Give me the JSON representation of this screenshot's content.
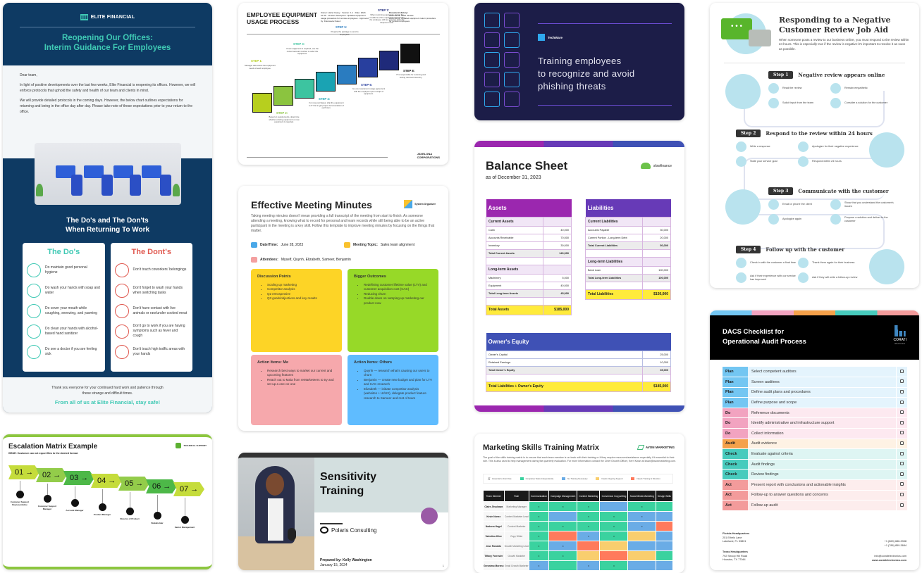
{
  "elite": {
    "brand": "ELITE FINANCIAL",
    "title_line1": "Reopening Our Offices:",
    "title_line2": "Interim Guidance For Employees",
    "greeting": "Dear team,",
    "para1": "In light of positive developments over the last few weeks, Elite Financial is reopening its offices. However, we will enforce protocols that uphold the safety and health of our team and clients in mind.",
    "para2": "We will provide detailed protocols in the coming days. However, the below chart outlines expectations for returning and being in the office day after day. Please take note of these expectations prior to your return to the office.",
    "section_line1": "The Do's and The Don'ts",
    "section_line2": "When Returning To Work",
    "dos_title": "The Do's",
    "donts_title": "The Dont's",
    "dos": [
      {
        "icon": "bathtub-icon",
        "text": "Do maintain good personal hygiene"
      },
      {
        "icon": "soap-icon",
        "text": "Do wash your hands with soap and water"
      },
      {
        "icon": "cough-icon",
        "text": "Do cover your mouth while coughing, sneezing, and yawning"
      },
      {
        "icon": "sanitizer-icon",
        "text": "Do clean your hands with alcohol-based hand sanitizer"
      },
      {
        "icon": "stethoscope-icon",
        "text": "Do see a doctor if you are feeling sick"
      }
    ],
    "donts": [
      {
        "icon": "desk-icon",
        "text": "Don't touch coworkers' belongings"
      },
      {
        "icon": "no-hands-icon",
        "text": "Don't forget to wash your hands when switching tasks"
      },
      {
        "icon": "utensils-icon",
        "text": "Don't have contact with live animals or raw/under cooked meat"
      },
      {
        "icon": "thermometer-icon",
        "text": "Don't go to work if you are having symptoms such as fever and cough"
      },
      {
        "icon": "pointing-hand-icon",
        "text": "Don't touch high traffic areas with your hands"
      }
    ],
    "thanks": "Thank you everyone for your continued hard work and patience through these strange and difficult times.",
    "signoff": "From all of us at Elite Financial, stay safe!",
    "colors": {
      "navy": "#0e3a63",
      "teal": "#3fc9b4",
      "red": "#e0584f"
    }
  },
  "escalation": {
    "title": "Escalation Matrix Example",
    "issue": "ISSUE: Customer can not export files to the desired format.",
    "brand": "TECHNICAL SUPPORT",
    "steps": [
      {
        "num": "01",
        "role": "Customer Support Representative",
        "color": "#c5dc3b"
      },
      {
        "num": "02",
        "role": "Customer Support Manager",
        "color": "#93cc4a"
      },
      {
        "num": "03",
        "role": "Account Manager",
        "color": "#4db848"
      },
      {
        "num": "04",
        "role": "Product Manager",
        "color": "#c5dc3b"
      },
      {
        "num": "05",
        "role": "Director of Product",
        "color": "#93cc4a"
      },
      {
        "num": "06",
        "role": "Stakeholder",
        "color": "#4db848"
      },
      {
        "num": "07",
        "role": "Senior Management",
        "color": "#c5dc3b"
      }
    ]
  },
  "equipment": {
    "title_line1": "EMPLOYEE EQUIPMENT",
    "title_line2": "USAGE PROCESS",
    "meta": "Owner: Hazel Casey · Version: 1.1 · Date: 2023-10-16 · Version description: Updated equipment usage procedure for remote employees · Approved by: Francesca Nunez",
    "history_title": "Document History:",
    "history": [
      "2022-09-29: Initial release",
      "2023-10-16: Updated equipment return procedure for remote employees"
    ],
    "steps": [
      {
        "label": "STEP 1:",
        "desc": "Manager will assess the equipment needs of each employee.",
        "color": "#b7cf1e"
      },
      {
        "label": "STEP 2:",
        "desc": "Based on requirements, determine whether existing equipment or new equipment is required.",
        "color": "#8bc43f"
      },
      {
        "label": "STEP 3:",
        "desc": "If new equipment is required, use the correct account number to order the equipment.",
        "color": "#3dc4a0"
      },
      {
        "label": "STEP 4:",
        "desc": "For new purchases, ship the equipment to IT first to get proper documentation of each item.",
        "color": "#1aa3b3"
      },
      {
        "label": "STEP 5:",
        "desc": "Prepare the package to send to employees.",
        "color": "#2a7cc0"
      },
      {
        "label": "STEP 6:",
        "desc": "Go over equipment usage agreement with the employee upon receipt of equipment.",
        "color": "#283f9e"
      },
      {
        "label": "STEP 7:",
        "desc": "When returning equipment, review the conditions of the equipment and provide the employee with an expense claim for shipment costs.",
        "color": "#1f2a7a"
      },
      {
        "label": "STEP 8:",
        "desc": "IT is responsible for receiving and storing returned inventory.",
        "color": "#111111"
      }
    ],
    "brand_line1": "JAVELONA",
    "brand_line2": "CORPORATIONS"
  },
  "meeting": {
    "title": "Effective Meeting Minutes",
    "brand": "System Organizer",
    "intro": "Taking meeting minutes doesn't mean providing a full transcript of the meeting from start to finish. As someone attending a meeting, knowing what to record for personal and team records while still being able to be an active participant in the meeting is a key skill. Follow this template to improve meeting minutes by focusing on the things that matter.",
    "date_label": "Date/Time:",
    "date_value": "June 28, 2023",
    "topic_label": "Meeting Topic:",
    "topic_value": "Sales team alignment",
    "attendees_label": "Attendees:",
    "attendees_value": "Myself, Quynh, Elizabeth, Sameer, Benjamin",
    "boxes": [
      {
        "title": "Discussion Points",
        "color": "#fdd426",
        "items": [
          "Scaling up marketing",
          "Competitor analysis",
          "Q2 retrospective",
          "Q3 goals/objectives and key results"
        ]
      },
      {
        "title": "Bigger Outcomes",
        "color": "#97d928",
        "items": [
          "Redefining customer lifetime value (LTV) and customer acquisition cost (CAC)",
          "Reducing churn",
          "Double down on vamping up marketing our product now"
        ]
      },
      {
        "title": "Action Items: Me",
        "color": "#f6a8ac",
        "items": [
          "Research best ways to market our current and upcoming features",
          "Reach out to Maia from reMarketeers to try and set up a one-on-one"
        ]
      },
      {
        "title": "Action Items: Others",
        "color": "#5fbcff",
        "items": [
          "Quynh — research what's causing our users to churn",
          "Benjamin — create new budget and plan for LTV and CAC research",
          "Elizabeth — initiate competitor analysis (websites + UI/UX), delegate product feature research to Sameer and rest of team"
        ]
      }
    ]
  },
  "sensitivity": {
    "title_line1": "Sensitivity",
    "title_line2": "Training",
    "brand": "Polaris Consulting",
    "prepared": "Prepared by: Kelly Washington",
    "date": "January 15, 2024",
    "page": "1"
  },
  "techware": {
    "brand": "TechWare",
    "title_line1": "Training employees",
    "title_line2": "to recognize and avoid",
    "title_line3": "phishing threats"
  },
  "balance": {
    "title": "Balance Sheet",
    "asof": "as of December 31, 2023",
    "brand": "slowfinance",
    "assets": {
      "title": "Assets",
      "current_title": "Current Assets",
      "current": [
        [
          "Cash",
          "40,000"
        ],
        [
          "Accounts Receivable",
          "70,000"
        ],
        [
          "Inventory",
          "30,000"
        ]
      ],
      "current_total": [
        "Total Current Assets",
        "140,000"
      ],
      "longterm_title": "Long-term Assets",
      "longterm": [
        [
          "Machinery",
          "5,000"
        ],
        [
          "Equipment",
          "40,000"
        ]
      ],
      "longterm_total": [
        "Total Long-term Assets",
        "45,000"
      ],
      "grand": [
        "Total Assets",
        "$185,000"
      ]
    },
    "liabilities": {
      "title": "Liabilities",
      "current_title": "Current Liabilities",
      "current": [
        [
          "Accounts Payable",
          "30,000"
        ],
        [
          "Current Portion - Long-term Debt",
          "20,000"
        ]
      ],
      "current_total": [
        "Total Current Liabilities",
        "50,000"
      ],
      "longterm_title": "Long-term Liabilities",
      "longterm": [
        [
          "Bank Loan",
          "100,000"
        ]
      ],
      "longterm_total": [
        "Total Long-term Liabilities",
        "100,000"
      ],
      "grand": [
        "Total Liabilities",
        "$150,000"
      ]
    },
    "equity": {
      "title": "Owner's Equity",
      "rows": [
        [
          "Owner's Capital",
          "25,000"
        ],
        [
          "Retained Earnings",
          "10,000"
        ]
      ],
      "total": [
        "Total Owner's Equity",
        "35,000"
      ],
      "grand": [
        "Total Liabilities + Owner's Equity",
        "$185,000"
      ]
    }
  },
  "marketing": {
    "title": "Marketing Skills Training Matrix",
    "brand": "AVON MARKETING",
    "desc": "The goal of the skills training matrix is to ensure that each team member is on track with their training or if they require resources/assistance especially if it essential to their role. This is also used to help management during the quarterly evaluation. For more information contact the Chief Growth Officer, Kerri Kwan at kwan@avonmarketing.com.",
    "legend": [
      {
        "label": "Essential to their Role",
        "color": "x"
      },
      {
        "label": "Completes Tasks Independently",
        "color": "#3ad29f"
      },
      {
        "label": "No Training Necessary",
        "color": "#6aace6"
      },
      {
        "label": "Needs Ongoing Support",
        "color": "#f9ce6e"
      },
      {
        "label": "Needs Training & Direction",
        "color": "#ff7a5c"
      }
    ],
    "headers": [
      "Team Member",
      "Role",
      "Communication",
      "Campaign Management",
      "Content Marketing",
      "Conversion Copywriting",
      "Social Media Marketing",
      "Design Skills"
    ],
    "rows": [
      {
        "name": "Claire Jitsukawa",
        "role": "Marketing Manager",
        "cells": [
          [
            "g",
            "x"
          ],
          [
            "g",
            "x"
          ],
          [
            "g",
            "x"
          ],
          [
            "b",
            ""
          ],
          [
            "g",
            "x"
          ],
          [
            "g",
            ""
          ]
        ]
      },
      {
        "name": "Kevin Nunez",
        "role": "Content Marketer Lead",
        "cells": [
          [
            "g",
            "x"
          ],
          [
            "b",
            ""
          ],
          [
            "g",
            "x"
          ],
          [
            "g",
            "x"
          ],
          [
            "b",
            "x"
          ],
          [
            "b",
            ""
          ]
        ]
      },
      {
        "name": "Nadeem Hagel",
        "role": "Content Marketer",
        "cells": [
          [
            "g",
            "x"
          ],
          [
            "g",
            "x"
          ],
          [
            "g",
            "x"
          ],
          [
            "g",
            "x"
          ],
          [
            "b",
            "x"
          ],
          [
            "r",
            ""
          ]
        ]
      },
      {
        "name": "Valentina Kline",
        "role": "Copy Writer",
        "cells": [
          [
            "g",
            "x"
          ],
          [
            "r",
            ""
          ],
          [
            "b",
            "x"
          ],
          [
            "g",
            "x"
          ],
          [
            "y",
            ""
          ],
          [
            "b",
            ""
          ]
        ]
      },
      {
        "name": "Jose Ronaldo",
        "role": "Growth Marketing Lead",
        "cells": [
          [
            "g",
            "x"
          ],
          [
            "b",
            "x"
          ],
          [
            "r",
            ""
          ],
          [
            "y",
            ""
          ],
          [
            "b",
            ""
          ],
          [
            "b",
            ""
          ]
        ]
      },
      {
        "name": "Tiffany Forrester",
        "role": "Growth Marketer",
        "cells": [
          [
            "g",
            "x"
          ],
          [
            "g",
            "x"
          ],
          [
            "y",
            ""
          ],
          [
            "r",
            ""
          ],
          [
            "y",
            ""
          ],
          [
            "g",
            ""
          ]
        ]
      },
      {
        "name": "Geronimo Moreno",
        "role": "Email Growth Marketer",
        "cells": [
          [
            "b",
            "x"
          ],
          [
            "g",
            ""
          ],
          [
            "b",
            "x"
          ],
          [
            "g",
            "x"
          ],
          [
            "b",
            ""
          ],
          [
            "b",
            ""
          ]
        ]
      }
    ]
  },
  "review": {
    "title_line1": "Responding to a Negative",
    "title_line2": "Customer Review Job Aid",
    "intro": "When someone posts a review to our business online, you must respond to the review within 24 hours. This is especially true if the review is negative-it's important to resolve it as soon as possible.",
    "steps": [
      {
        "tag": "Step 1",
        "title": "Negative review appears online",
        "actions": [
          "Read the review",
          "Remain empathetic",
          "Solicit input from the team",
          "Consider a solution for the customer"
        ]
      },
      {
        "tag": "Step 2",
        "title": "Respond to the review within 24 hours",
        "actions": [
          "Write a response",
          "Apologize for their negative experience",
          "State your service goal",
          "Respond within 24 hours"
        ]
      },
      {
        "tag": "Step 3",
        "title": "Communicate with the customer",
        "actions": [
          "Email or phone the client",
          "Show that you understand the customer's issues",
          "Apologize again",
          "Propose a solution and deliver to the customer"
        ]
      },
      {
        "tag": "Step 4",
        "title": "Follow up with the customer",
        "actions": [
          "Check in with the customer a final time",
          "Thank them again for their business",
          "Ask if their experience with our service has improved",
          "Ask if they will write a follow-up review"
        ]
      }
    ]
  },
  "dacs": {
    "title_line1": "DACS Checklist for",
    "title_line2": "Operational Audit Process",
    "brand": "CORATI",
    "brand_sub": "Electronics",
    "phase_colors": {
      "Plan": [
        "#73c6f2",
        "#e4f4fd"
      ],
      "Do": [
        "#f2a3c0",
        "#fde9f0"
      ],
      "Audit": [
        "#f5a14a",
        "#fef2e4"
      ],
      "Check": [
        "#47cbbd",
        "#def5f3"
      ],
      "Act": [
        "#f39b9b",
        "#fdeded"
      ]
    },
    "items": [
      {
        "phase": "Plan",
        "text": "Select competent auditors"
      },
      {
        "phase": "Plan",
        "text": "Screen auditees"
      },
      {
        "phase": "Plan",
        "text": "Define audit plans and procedures"
      },
      {
        "phase": "Plan",
        "text": "Define purpose and scope"
      },
      {
        "phase": "Do",
        "text": "Reference documents"
      },
      {
        "phase": "Do",
        "text": "Identify administrative and infrastructure support"
      },
      {
        "phase": "Do",
        "text": "Collect information"
      },
      {
        "phase": "Audit",
        "text": "Audit evidence"
      },
      {
        "phase": "Check",
        "text": "Evaluate against criteria"
      },
      {
        "phase": "Check",
        "text": "Audit findings"
      },
      {
        "phase": "Check",
        "text": "Review findings"
      },
      {
        "phase": "Act",
        "text": "Present report with conclusions and actionable insights"
      },
      {
        "phase": "Act",
        "text": "Follow-up to answer questions and concerns"
      },
      {
        "phase": "Act",
        "text": "Follow-up audit"
      }
    ],
    "fl_title": "Florida Headquarters",
    "fl_addr1": "251 Ethels Lane",
    "fl_addr2": "Lakeland, FL 33801",
    "tx_title": "Texas Headquarters",
    "tx_addr1": "792 Stroop Hill Road",
    "tx_addr2": "Houston, TX 77044",
    "phone1": "+1 (863) 686-3338",
    "phone2": "+1 (786) 859-3684",
    "email": "info@coratielectronics.com",
    "web": "www.coratielectronics.com"
  }
}
